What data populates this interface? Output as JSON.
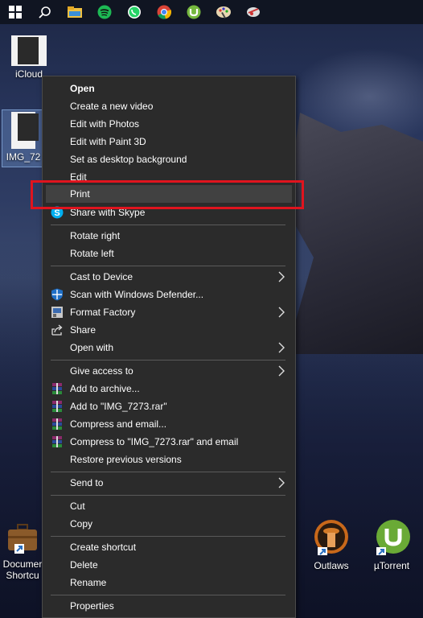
{
  "desktop": {
    "icons": [
      {
        "label": "iCloud"
      },
      {
        "label": "IMG_72"
      },
      {
        "label1": "Documer",
        "label2": "Shortcu"
      },
      {
        "label": "Outlaws"
      },
      {
        "label": "µTorrent"
      }
    ]
  },
  "taskbar": {
    "icons": [
      "windows-start-icon",
      "search-icon",
      "file-explorer-icon",
      "spotify-icon",
      "whatsapp-icon",
      "chrome-icon",
      "utorrent-icon",
      "paint-icon",
      "network-icon"
    ]
  },
  "menu": {
    "items": [
      {
        "label": "Open"
      },
      {
        "label": "Create a new video"
      },
      {
        "label": "Edit with Photos"
      },
      {
        "label": "Edit with Paint 3D"
      },
      {
        "label": "Set as desktop background"
      },
      {
        "label": "Edit"
      },
      {
        "label": "Print"
      },
      {
        "label": "Share with Skype"
      },
      {
        "label": "Rotate right"
      },
      {
        "label": "Rotate left"
      },
      {
        "label": "Cast to Device"
      },
      {
        "label": "Scan with Windows Defender..."
      },
      {
        "label": "Format Factory"
      },
      {
        "label": "Share"
      },
      {
        "label": "Open with"
      },
      {
        "label": "Give access to"
      },
      {
        "label": "Add to archive..."
      },
      {
        "label": "Add to \"IMG_7273.rar\""
      },
      {
        "label": "Compress and email..."
      },
      {
        "label": "Compress to \"IMG_7273.rar\" and email"
      },
      {
        "label": "Restore previous versions"
      },
      {
        "label": "Send to"
      },
      {
        "label": "Cut"
      },
      {
        "label": "Copy"
      },
      {
        "label": "Create shortcut"
      },
      {
        "label": "Delete"
      },
      {
        "label": "Rename"
      },
      {
        "label": "Properties"
      }
    ]
  },
  "colors": {
    "highlight_box": "#e0141e",
    "menu_bg": "#2b2b2b"
  }
}
